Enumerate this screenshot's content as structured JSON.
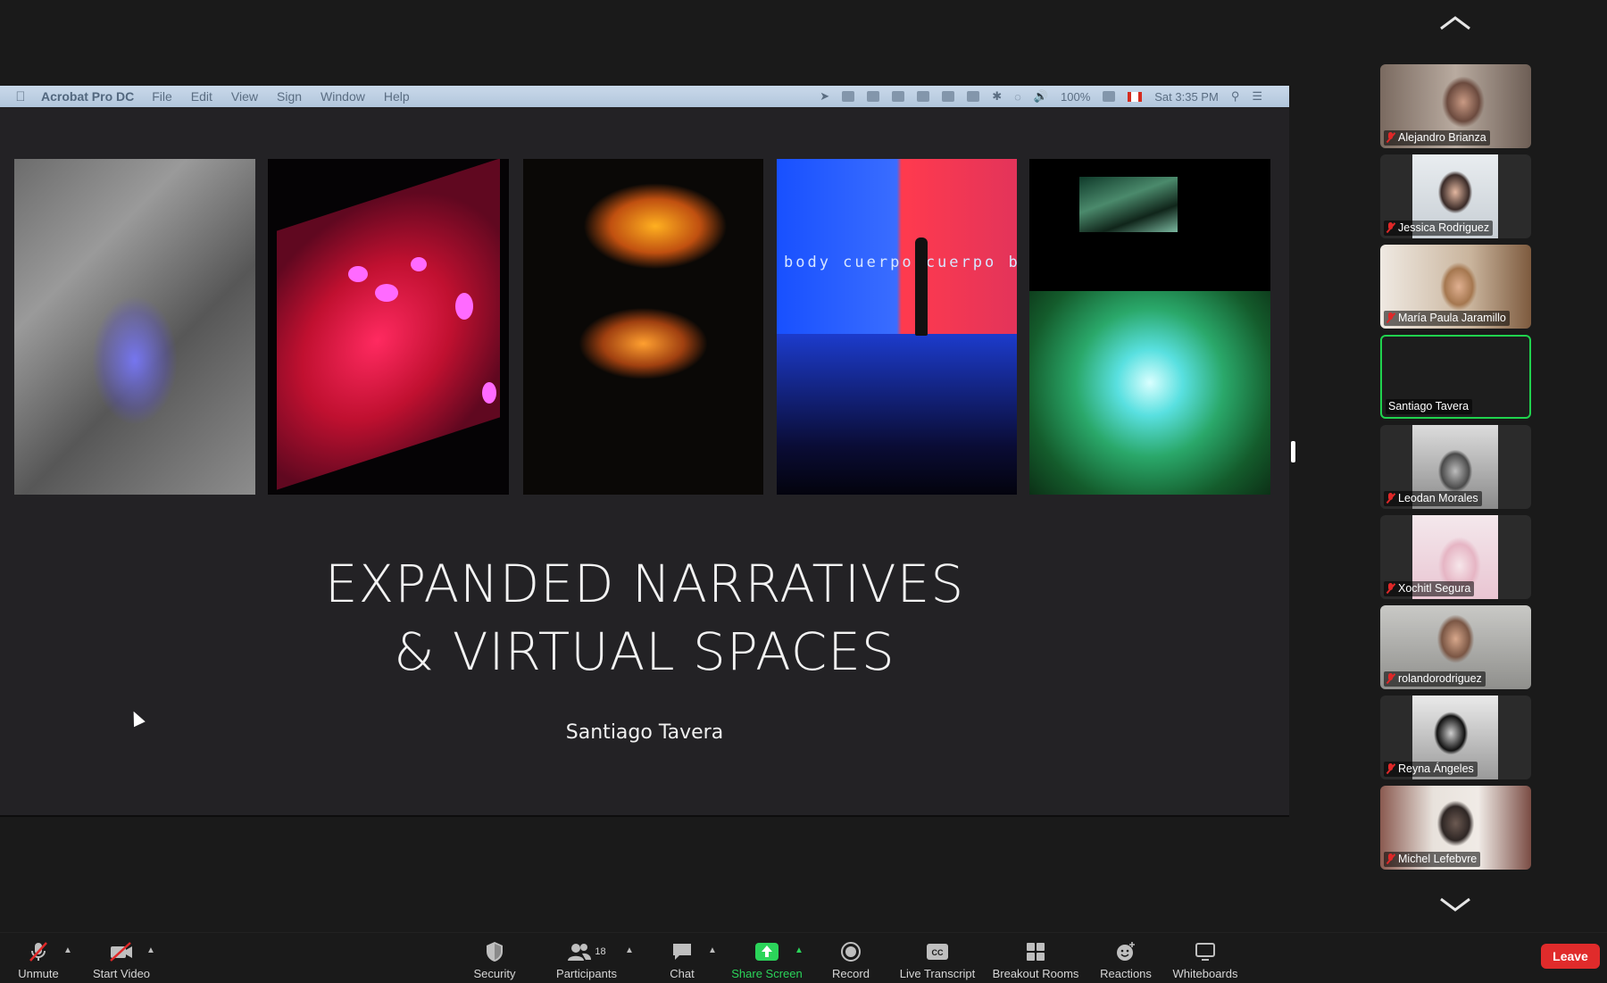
{
  "shared_screen": {
    "menubar": {
      "app_name": "Acrobat Pro DC",
      "menus": [
        "File",
        "Edit",
        "View",
        "Sign",
        "Window",
        "Help"
      ],
      "battery": "100%",
      "clock": "Sat 3:35 PM"
    },
    "slide": {
      "title_line1": "EXPANDED NARRATIVES",
      "title_line2": "& VIRTUAL SPACES",
      "author": "Santiago Tavera",
      "image4_text": "body cuerpo cuerpo bod z"
    }
  },
  "gallery": {
    "participants": [
      {
        "name": "Alejandro Brianza",
        "muted": true,
        "video": true
      },
      {
        "name": "Jessica Rodriguez",
        "muted": true,
        "video": true
      },
      {
        "name": "María Paula Jaramillo",
        "muted": true,
        "video": true
      },
      {
        "name": "Santiago Tavera",
        "muted": false,
        "video": false,
        "active_speaker": true
      },
      {
        "name": "Leodan Morales",
        "muted": true,
        "video": true
      },
      {
        "name": "Xochitl Segura",
        "muted": true,
        "video": true
      },
      {
        "name": "rolandorodriguez",
        "muted": true,
        "video": true
      },
      {
        "name": "Reyna Ángeles",
        "muted": true,
        "video": true
      },
      {
        "name": "Michel Lefebvre",
        "muted": true,
        "video": true
      }
    ]
  },
  "toolbar": {
    "unmute": "Unmute",
    "start_video": "Start Video",
    "security": "Security",
    "participants": "Participants",
    "participants_count": "18",
    "chat": "Chat",
    "share_screen": "Share Screen",
    "record": "Record",
    "live_transcript": "Live Transcript",
    "breakout_rooms": "Breakout Rooms",
    "reactions": "Reactions",
    "whiteboards": "Whiteboards",
    "leave": "Leave"
  },
  "colors": {
    "share_green": "#2bd45a",
    "leave_red": "#e02b2b",
    "active_speaker_border": "#20d34e",
    "muted_red": "#e02828"
  }
}
